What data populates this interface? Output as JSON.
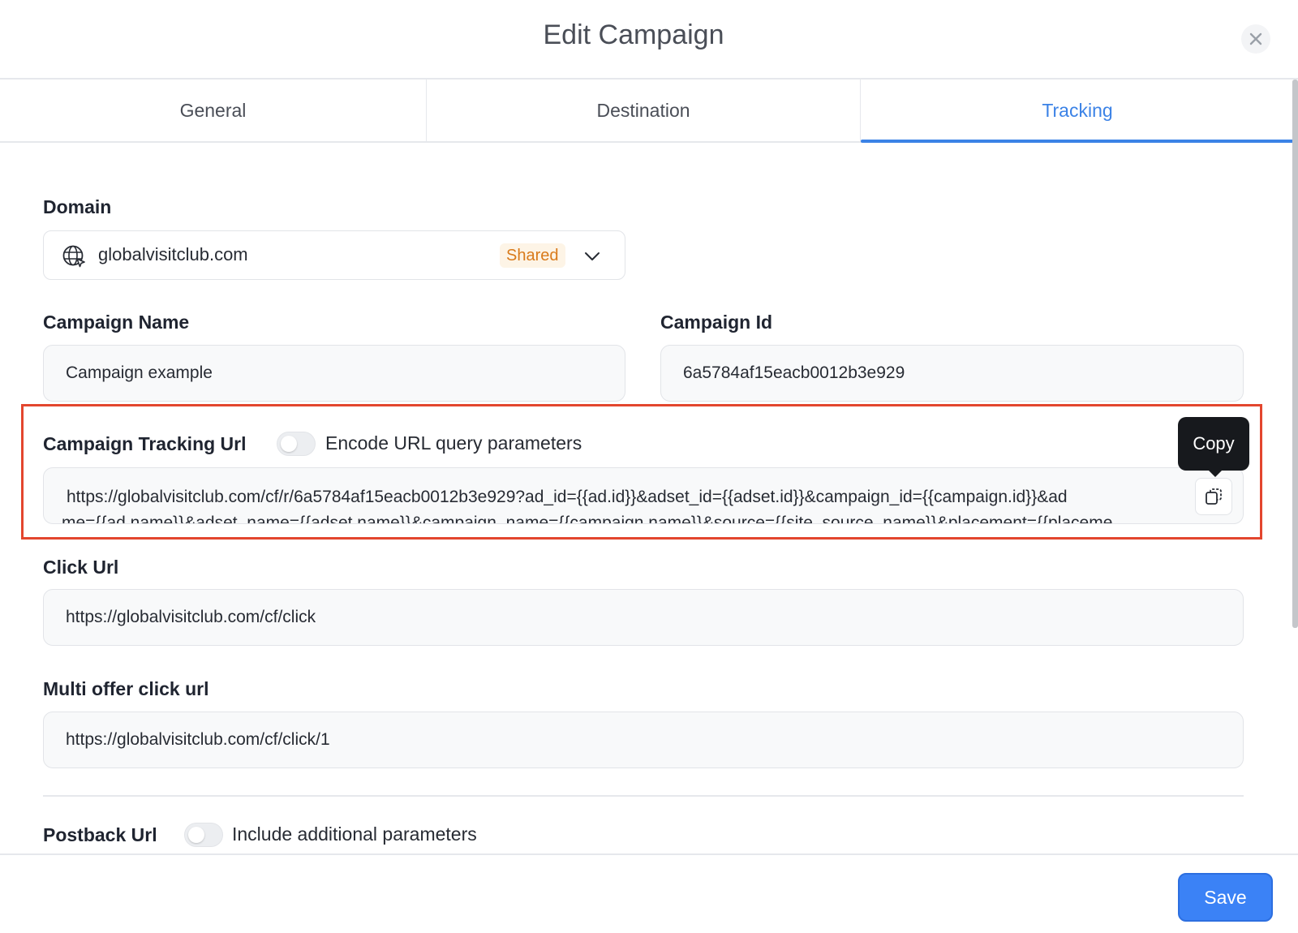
{
  "dialog": {
    "title": "Edit Campaign",
    "close_icon": "close-icon"
  },
  "tabs": [
    {
      "label": "General",
      "active": false
    },
    {
      "label": "Destination",
      "active": false
    },
    {
      "label": "Tracking",
      "active": true
    }
  ],
  "domain": {
    "label": "Domain",
    "value": "globalvisitclub.com",
    "badge": "Shared",
    "icon": "globe-icon"
  },
  "campaign_name": {
    "label": "Campaign Name",
    "value": "Campaign example"
  },
  "campaign_id": {
    "label": "Campaign Id",
    "value": "6a5784af15eacb0012b3e929"
  },
  "tracking_url": {
    "label": "Campaign Tracking Url",
    "toggle_label": "Encode URL query parameters",
    "toggle_on": false,
    "line1": "https://globalvisitclub.com/cf/r/6a5784af15eacb0012b3e929?ad_id={{ad.id}}&adset_id={{adset.id}}&campaign_id={{campaign.id}}&ad",
    "line2": "me={{ad.name}}&adset_name={{adset.name}}&campaign_name={{campaign.name}}&source={{site_source_name}}&placement={{placeme",
    "copy_tooltip": "Copy"
  },
  "click_url": {
    "label": "Click Url",
    "value": "https://globalvisitclub.com/cf/click"
  },
  "multi_offer_url": {
    "label": "Multi offer click url",
    "value": "https://globalvisitclub.com/cf/click/1"
  },
  "postback_url": {
    "label": "Postback Url",
    "toggle_label": "Include additional parameters",
    "toggle_on": false
  },
  "footer": {
    "save_label": "Save"
  },
  "colors": {
    "accent": "#3b82f6",
    "highlight": "#e3462e",
    "badge_text": "#d97a1a"
  }
}
